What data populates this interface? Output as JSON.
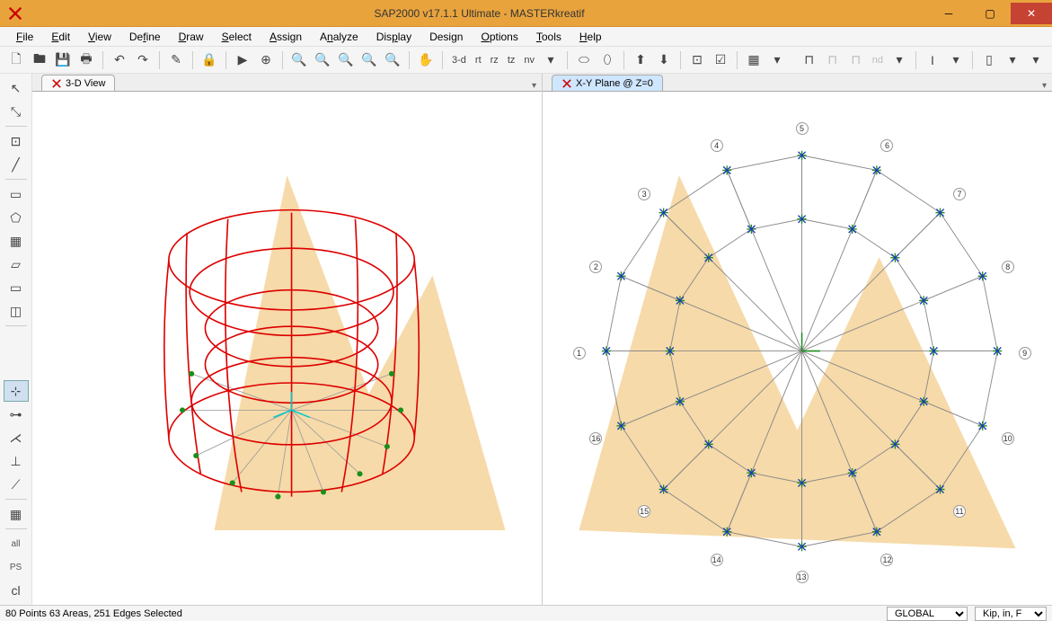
{
  "app": {
    "title": "SAP2000 v17.1.1 Ultimate  -  MASTERkreatif"
  },
  "menu": {
    "file": "File",
    "edit": "Edit",
    "view": "View",
    "define": "Define",
    "draw": "Draw",
    "select": "Select",
    "assign": "Assign",
    "analyze": "Analyze",
    "display": "Display",
    "design": "Design",
    "options": "Options",
    "tools": "Tools",
    "help": "Help"
  },
  "toolbar": {
    "txt_3d": "3-d",
    "txt_rt": "rt",
    "txt_rz": "rz",
    "txt_tz": "tz",
    "txt_nv": "nv",
    "txt_nd": "nd"
  },
  "left_tools": {
    "all": "all",
    "ps": "PS"
  },
  "views": {
    "left": {
      "tab": "3-D View"
    },
    "right": {
      "tab": "X-Y Plane @ Z=0"
    }
  },
  "plan_nodes": [
    "1",
    "2",
    "3",
    "4",
    "5",
    "6",
    "7",
    "8",
    "9",
    "10",
    "11",
    "12",
    "13",
    "14",
    "15",
    "16"
  ],
  "status": {
    "selection": "80 Points  63 Areas,  251 Edges Selected",
    "coord_sys": "GLOBAL",
    "units": "Kip, in, F"
  }
}
